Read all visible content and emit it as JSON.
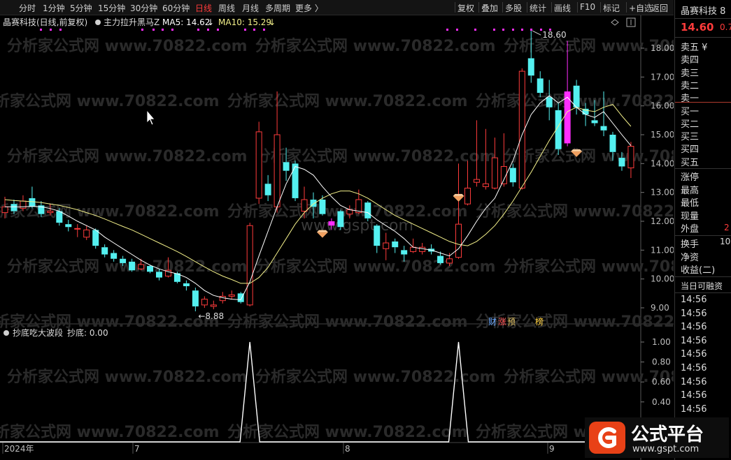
{
  "toolbar": {
    "periods": [
      "分时",
      "1分钟",
      "5分钟",
      "15分钟",
      "30分钟",
      "60分钟",
      "日线",
      "周线",
      "月线",
      "多周期",
      "更多 〉"
    ],
    "active_period": "日线",
    "actions": [
      "复权",
      "叠加",
      "多股",
      "统计",
      "画线",
      "F10",
      "标记",
      "+自选",
      "返回"
    ]
  },
  "main_chart": {
    "title": "晶赛科技(日线,前复权)",
    "indicator_name": "主力拉升黑马Z",
    "ma5_label": "MA5: 14.62",
    "ma5_arrow": "↓",
    "ma10_label": "MA10: 15.29",
    "ma10_arrow": "↓",
    "high_label": "18.60",
    "low_label": "8.88",
    "badges": [
      "财",
      "涨",
      "预",
      "榜"
    ],
    "y_ticks": [
      "18.00",
      "17.00",
      "16.00",
      "15.00",
      "14.00",
      "13.00",
      "12.00",
      "11.00",
      "10.00",
      "9.00"
    ],
    "watermark_text": "分析家公式网 www.70822.com",
    "watermark_site": "www.gspt.com"
  },
  "sub_chart": {
    "indicator_name": "抄底吃大波段",
    "value_label": "抄底: 0.00",
    "y_ticks": [
      "1.00",
      "0.80",
      "0.60",
      "0.40",
      "0.20"
    ],
    "x_labels": [
      "2024年",
      "7",
      "8",
      "9"
    ]
  },
  "right_panel": {
    "stock_name": "晶赛科技 8",
    "price": "14.60",
    "price_change": "0.7",
    "order_rows": [
      "卖五 ¥",
      "卖四",
      "卖三",
      "卖二",
      "卖一",
      "买一",
      "买二",
      "买三",
      "买四",
      "买五"
    ],
    "stats_rows": [
      "涨停",
      "最高",
      "最低",
      "现量",
      "外盘"
    ],
    "outer_value": "2",
    "finance_rows": [
      "换手",
      "净资",
      "收益(二)"
    ],
    "turnover_value": "10",
    "margin_label": "当日可融资",
    "times": [
      "14:56",
      "14:56",
      "14:56",
      "14:56",
      "14:56",
      "14:56",
      "14:56",
      "14:56",
      "14:56",
      "14:56",
      "14:56"
    ]
  },
  "logo": {
    "name": "公式平台",
    "url": "www.gspt.com"
  },
  "colors": {
    "up": "#ff3b3b",
    "down": "#54f0f0",
    "purple": "#ff2dff",
    "ma5": "#ffffff",
    "ma10": "#f3f08a",
    "bg": "#000000"
  },
  "chart_data": {
    "type": "candlestick",
    "ylim": [
      8.5,
      18.7
    ],
    "candles": [
      {
        "o": 12.3,
        "c": 12.5,
        "h": 12.85,
        "l": 12.1
      },
      {
        "o": 12.6,
        "c": 12.35,
        "h": 12.75,
        "l": 12.25
      },
      {
        "o": 12.45,
        "c": 12.7,
        "h": 12.9,
        "l": 12.35
      },
      {
        "o": 12.8,
        "c": 12.5,
        "h": 13.2,
        "l": 12.45
      },
      {
        "o": 12.55,
        "c": 12.25,
        "h": 12.7,
        "l": 12.15
      },
      {
        "o": 12.3,
        "c": 12.35,
        "h": 12.6,
        "l": 12.2
      },
      {
        "o": 12.35,
        "c": 11.95,
        "h": 12.45,
        "l": 11.85
      },
      {
        "o": 11.9,
        "c": 11.8,
        "h": 12.05,
        "l": 11.65
      },
      {
        "o": 11.75,
        "c": 11.75,
        "h": 11.9,
        "l": 11.45
      },
      {
        "o": 11.45,
        "c": 11.7,
        "h": 11.85,
        "l": 11.35
      },
      {
        "o": 11.7,
        "c": 11.15,
        "h": 11.75,
        "l": 11.05
      },
      {
        "o": 11.1,
        "c": 10.85,
        "h": 11.2,
        "l": 10.75
      },
      {
        "o": 10.9,
        "c": 10.7,
        "h": 11.0,
        "l": 10.6
      },
      {
        "o": 10.7,
        "c": 10.55,
        "h": 10.8,
        "l": 10.45
      },
      {
        "o": 10.6,
        "c": 10.3,
        "h": 10.7,
        "l": 10.25
      },
      {
        "o": 10.35,
        "c": 10.5,
        "h": 10.7,
        "l": 10.3
      },
      {
        "o": 10.45,
        "c": 10.25,
        "h": 10.5,
        "l": 10.2
      },
      {
        "o": 10.25,
        "c": 10.05,
        "h": 10.35,
        "l": 9.95
      },
      {
        "o": 10.1,
        "c": 10.3,
        "h": 10.75,
        "l": 10.05
      },
      {
        "o": 10.2,
        "c": 9.9,
        "h": 10.25,
        "l": 9.85
      },
      {
        "o": 9.85,
        "c": 9.75,
        "h": 9.95,
        "l": 9.6
      },
      {
        "o": 9.6,
        "c": 9.05,
        "h": 9.7,
        "l": 8.88
      },
      {
        "o": 9.1,
        "c": 9.3,
        "h": 9.4,
        "l": 9.0
      },
      {
        "o": 9.05,
        "c": 9.1,
        "h": 9.25,
        "l": 8.95
      },
      {
        "o": 9.25,
        "c": 9.4,
        "h": 9.55,
        "l": 9.15
      },
      {
        "o": 9.4,
        "c": 9.45,
        "h": 9.6,
        "l": 9.3
      },
      {
        "o": 9.5,
        "c": 9.2,
        "h": 9.55,
        "l": 9.15
      },
      {
        "o": 9.1,
        "c": 11.85,
        "h": 11.95,
        "l": 9.05
      },
      {
        "o": 12.8,
        "c": 15.1,
        "h": 15.45,
        "l": 12.6
      },
      {
        "o": 13.3,
        "c": 12.9,
        "h": 13.6,
        "l": 12.7
      },
      {
        "o": 12.5,
        "c": 15.0,
        "h": 16.5,
        "l": 12.3
      },
      {
        "o": 14.05,
        "c": 13.75,
        "h": 14.55,
        "l": 13.4
      },
      {
        "o": 14.0,
        "c": 12.8,
        "h": 14.1,
        "l": 12.7
      },
      {
        "o": 12.35,
        "c": 12.75,
        "h": 13.2,
        "l": 12.1
      },
      {
        "o": 12.75,
        "c": 12.5,
        "h": 13.0,
        "l": 12.1
      },
      {
        "o": 12.75,
        "c": 12.25,
        "h": 12.9,
        "l": 12.2
      },
      {
        "o": 12.0,
        "c": 11.85,
        "h": 12.1,
        "l": 11.7
      },
      {
        "o": 12.35,
        "c": 11.8,
        "h": 12.4,
        "l": 11.7
      },
      {
        "o": 12.25,
        "c": 12.4,
        "h": 12.55,
        "l": 12.1
      },
      {
        "o": 12.3,
        "c": 12.75,
        "h": 13.1,
        "l": 12.25
      },
      {
        "o": 12.65,
        "c": 12.1,
        "h": 12.7,
        "l": 12.0
      },
      {
        "o": 11.85,
        "c": 11.15,
        "h": 11.9,
        "l": 10.9
      },
      {
        "o": 11.05,
        "c": 11.25,
        "h": 11.6,
        "l": 10.65
      },
      {
        "o": 11.3,
        "c": 11.1,
        "h": 11.4,
        "l": 10.9
      },
      {
        "o": 11.0,
        "c": 10.85,
        "h": 11.15,
        "l": 10.6
      },
      {
        "o": 10.95,
        "c": 11.1,
        "h": 11.4,
        "l": 10.9
      },
      {
        "o": 10.95,
        "c": 11.1,
        "h": 11.25,
        "l": 10.85
      },
      {
        "o": 11.05,
        "c": 10.95,
        "h": 11.2,
        "l": 10.85
      },
      {
        "o": 10.8,
        "c": 10.55,
        "h": 10.95,
        "l": 10.5
      },
      {
        "o": 10.55,
        "c": 10.7,
        "h": 10.9,
        "l": 10.45
      },
      {
        "o": 10.75,
        "c": 11.9,
        "h": 14.0,
        "l": 10.7
      },
      {
        "o": 12.6,
        "c": 13.15,
        "h": 14.1,
        "l": 12.55
      },
      {
        "o": 13.35,
        "c": 13.45,
        "h": 15.5,
        "l": 13.2
      },
      {
        "o": 13.2,
        "c": 13.3,
        "h": 15.2,
        "l": 13.1
      },
      {
        "o": 13.15,
        "c": 14.2,
        "h": 14.9,
        "l": 13.1
      },
      {
        "o": 13.3,
        "c": 13.9,
        "h": 15.05,
        "l": 13.2
      },
      {
        "o": 13.85,
        "c": 13.35,
        "h": 14.0,
        "l": 13.2
      },
      {
        "o": 13.15,
        "c": 17.2,
        "h": 17.3,
        "l": 13.1
      },
      {
        "o": 17.65,
        "c": 17.05,
        "h": 18.6,
        "l": 16.8
      },
      {
        "o": 16.95,
        "c": 16.45,
        "h": 17.2,
        "l": 16.3
      },
      {
        "o": 16.3,
        "c": 15.95,
        "h": 16.9,
        "l": 15.5
      },
      {
        "o": 15.85,
        "c": 14.5,
        "h": 16.1,
        "l": 14.3
      },
      {
        "o": 14.7,
        "c": 16.5,
        "h": 18.25,
        "l": 14.6
      },
      {
        "o": 16.7,
        "c": 15.95,
        "h": 16.9,
        "l": 15.7
      },
      {
        "o": 15.9,
        "c": 15.7,
        "h": 16.1,
        "l": 15.3
      },
      {
        "o": 15.5,
        "c": 15.4,
        "h": 16.2,
        "l": 15.3
      },
      {
        "o": 15.3,
        "c": 15.15,
        "h": 16.5,
        "l": 14.95
      },
      {
        "o": 15.0,
        "c": 14.4,
        "h": 15.1,
        "l": 14.1
      },
      {
        "o": 14.2,
        "c": 13.9,
        "h": 14.4,
        "l": 13.75
      },
      {
        "o": 13.85,
        "c": 14.6,
        "h": 14.75,
        "l": 13.5
      }
    ],
    "purple_candles": [
      36,
      62
    ],
    "ma5": [
      12.5,
      12.5,
      12.5,
      12.52,
      12.5,
      12.44,
      12.35,
      12.18,
      12.0,
      11.85,
      11.7,
      11.45,
      11.25,
      11.05,
      10.85,
      10.65,
      10.48,
      10.35,
      10.25,
      10.18,
      10.05,
      9.85,
      9.6,
      9.43,
      9.35,
      9.3,
      9.28,
      9.9,
      10.8,
      11.65,
      12.5,
      13.3,
      13.9,
      13.8,
      13.6,
      13.2,
      12.85,
      12.55,
      12.4,
      12.35,
      12.3,
      12.05,
      11.85,
      11.65,
      11.4,
      11.1,
      11.05,
      11.0,
      10.9,
      10.8,
      11.05,
      11.5,
      12.0,
      12.45,
      12.8,
      13.45,
      14.1,
      15.0,
      15.7,
      16.1,
      16.35,
      16.1,
      16.3,
      15.95,
      15.7,
      15.6,
      15.8,
      15.4,
      15.0,
      14.62
    ],
    "ma10": [
      12.75,
      12.72,
      12.7,
      12.68,
      12.65,
      12.6,
      12.55,
      12.48,
      12.4,
      12.3,
      12.2,
      12.08,
      11.95,
      11.82,
      11.7,
      11.55,
      11.4,
      11.25,
      11.1,
      10.95,
      10.78,
      10.6,
      10.42,
      10.25,
      10.1,
      9.98,
      9.85,
      9.85,
      10.05,
      10.4,
      10.9,
      11.4,
      11.9,
      12.3,
      12.6,
      12.8,
      12.95,
      13.05,
      13.05,
      12.95,
      12.8,
      12.6,
      12.4,
      12.2,
      12.05,
      11.9,
      11.75,
      11.6,
      11.45,
      11.3,
      11.2,
      11.15,
      11.3,
      11.55,
      11.85,
      12.25,
      12.7,
      13.2,
      13.7,
      14.25,
      14.8,
      15.3,
      15.8,
      15.95,
      15.85,
      15.8,
      15.95,
      16.05,
      15.65,
      15.29
    ],
    "diamonds": [
      {
        "i": 35,
        "v": 11.55
      },
      {
        "i": 50,
        "v": 12.8
      },
      {
        "i": 63,
        "v": 14.35
      }
    ],
    "sub_series": {
      "name": "抄底",
      "peaks": [
        27,
        50
      ],
      "ylim": [
        0,
        1
      ]
    }
  }
}
